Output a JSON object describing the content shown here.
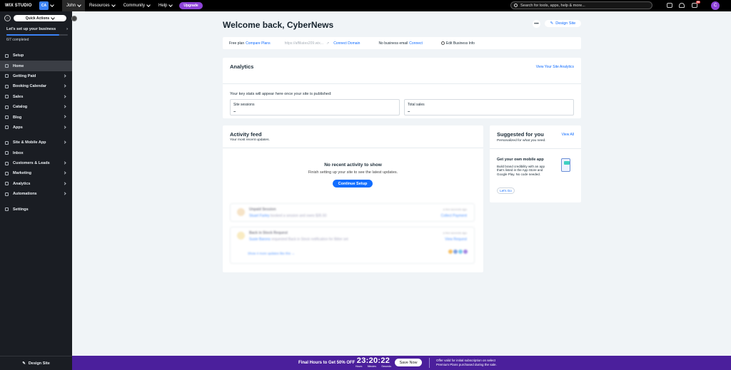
{
  "topbar": {
    "brand": "WIX STUDIO",
    "workspace": "CA",
    "user": "John",
    "menu": [
      "Resources",
      "Community",
      "Help"
    ],
    "upgrade": "Upgrade",
    "search_placeholder": "Search for tools, apps, help & more...",
    "notif_badge": "99",
    "avatar_letter": "C"
  },
  "sidebar": {
    "quick_actions": "Quick Actions",
    "setup_title": "Let's set up your business",
    "setup_progress": 0.857,
    "completed": "6/7 completed",
    "items": [
      {
        "label": "Setup",
        "arrow": false
      },
      {
        "label": "Home",
        "arrow": false,
        "active": true
      },
      {
        "label": "Getting Paid",
        "arrow": true
      },
      {
        "label": "Booking Calendar",
        "arrow": true
      },
      {
        "label": "Sales",
        "arrow": true
      },
      {
        "label": "Catalog",
        "arrow": true
      },
      {
        "label": "Blog",
        "arrow": true
      },
      {
        "label": "Apps",
        "arrow": true
      },
      {
        "label": "Site & Mobile App",
        "arrow": true,
        "gap": true
      },
      {
        "label": "Inbox",
        "arrow": false
      },
      {
        "label": "Customers & Leads",
        "arrow": true
      },
      {
        "label": "Marketing",
        "arrow": true
      },
      {
        "label": "Analytics",
        "arrow": true
      },
      {
        "label": "Automations",
        "arrow": true
      },
      {
        "label": "Settings",
        "arrow": false,
        "gap": true
      }
    ],
    "design_site": "Design Site"
  },
  "main": {
    "welcome": "Welcome back, CyberNews",
    "more": "•••",
    "design_site": "Design Site",
    "info": {
      "plan": "Free plan",
      "compare": "Compare Plans",
      "url": "https://affiliates209.wix...",
      "connect_domain": "Connect Domain",
      "email": "No business email",
      "connect": "Connect",
      "edit": "Edit Business Info"
    },
    "analytics": {
      "title": "Analytics",
      "link": "View Your Site Analytics",
      "text": "Your key stats will appear here once your site is published:",
      "stats": [
        {
          "label": "Site sessions",
          "value": "–"
        },
        {
          "label": "Total sales",
          "value": "–"
        }
      ]
    },
    "feed": {
      "title": "Activity feed",
      "subtitle": "Your most recent updates.",
      "empty_title": "No recent activity to show",
      "empty_text": "Finish setting up your site to see the latest updates.",
      "cta": "Continue Setup",
      "items": [
        {
          "title": "Unpaid Session",
          "person": "Stuart Farley",
          "desc": "booked a session and owes $35.50",
          "when": "a few seconds ago",
          "action": "Collect Payment"
        },
        {
          "title": "Back in Stock Request",
          "person": "Susie Barons",
          "desc": "requested Back in Stock notification for Bitter set",
          "when": "a few seconds ago",
          "action": "View Request"
        }
      ],
      "more_updates": "Show 4 more updates like this →"
    },
    "suggest": {
      "title": "Suggested for you",
      "subtitle": "Personalized for what you need.",
      "view_all": "View All",
      "card_title": "Get your own mobile app",
      "card_text": "Build brand credibility with an app that's listed in the App Store and Google Play. No code needed.",
      "cta": "Let's Go"
    }
  },
  "promo": {
    "text": "Final Hours to Get 50% OFF",
    "timer": "23:20:22",
    "units": [
      "Hours",
      "Minutes",
      "Seconds"
    ],
    "cta": "Save Now",
    "offer": "Offer valid for initial subscription on select Premium Plans purchased during the sale."
  }
}
